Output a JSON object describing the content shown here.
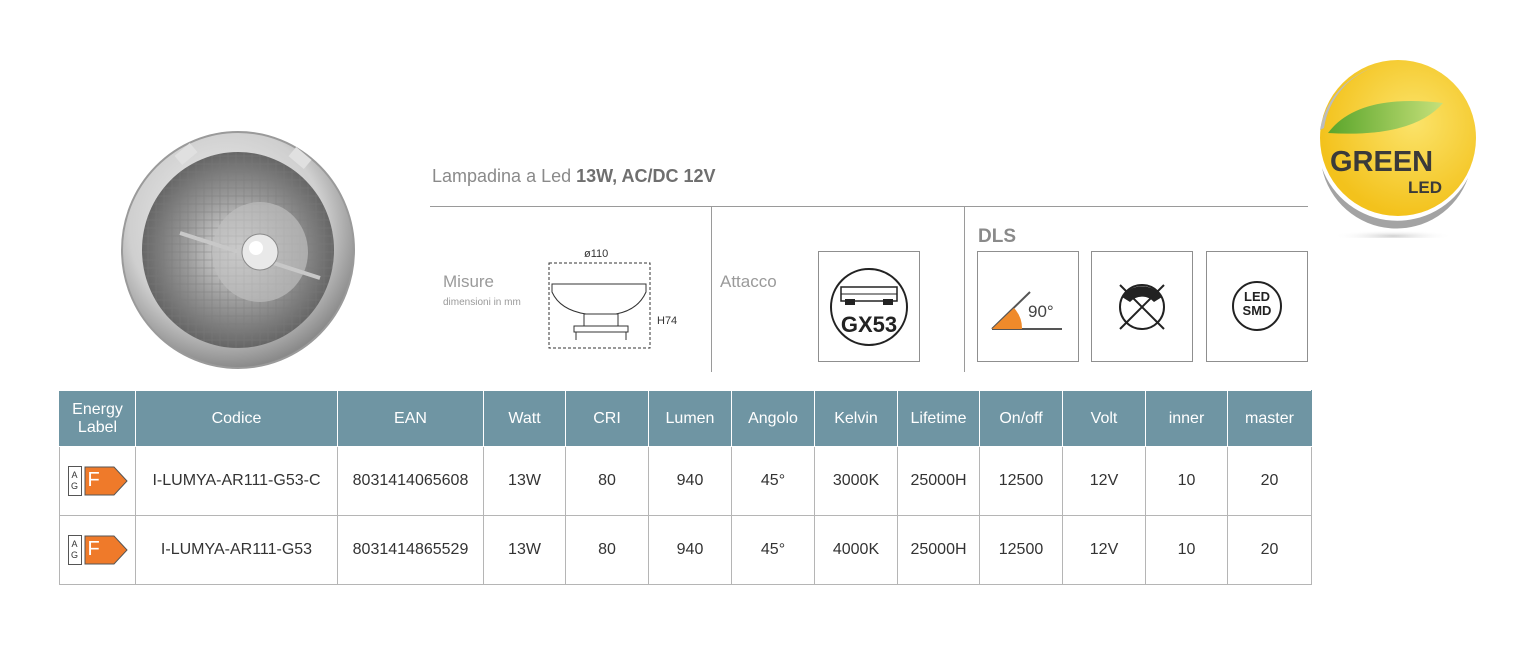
{
  "product": {
    "title_prefix": "Lampadina a Led",
    "title_specs": "13W, AC/DC 12V"
  },
  "sections": {
    "misure_label": "Misure",
    "misure_sub": "dimensioni in mm",
    "diameter": "ø110",
    "height": "H74",
    "attacco_label": "Attacco",
    "socket_code": "GX53",
    "dls_label": "DLS",
    "beam_angle": "90°",
    "led_type_line1": "LED",
    "led_type_line2": "SMD",
    "icons": [
      "beam-angle-icon",
      "no-dimmer-icon",
      "led-smd-icon"
    ]
  },
  "logo": {
    "word1": "GREEN",
    "word2": "LED",
    "colors": {
      "yellow": "#f3c21c",
      "green": "#8cc63f",
      "ring": "#a3a3a3"
    }
  },
  "table": {
    "header_color": "#6f95a3",
    "headers": [
      "Energy Label",
      "Codice",
      "EAN",
      "Watt",
      "CRI",
      "Lumen",
      "Angolo",
      "Kelvin",
      "Lifetime",
      "On/off",
      "Volt",
      "inner",
      "master"
    ],
    "energy_scale_top": "A",
    "energy_scale_bottom": "G",
    "rows": [
      {
        "energy_class": "F",
        "codice": "I-LUMYA-AR111-G53-C",
        "ean": "8031414065608",
        "watt": "13W",
        "cri": "80",
        "lumen": "940",
        "angolo": "45°",
        "kelvin": "3000K",
        "lifetime": "25000H",
        "onoff": "12500",
        "volt": "12V",
        "inner": "10",
        "master": "20"
      },
      {
        "energy_class": "F",
        "codice": "I-LUMYA-AR111-G53",
        "ean": "8031414865529",
        "watt": "13W",
        "cri": "80",
        "lumen": "940",
        "angolo": "45°",
        "kelvin": "4000K",
        "lifetime": "25000H",
        "onoff": "12500",
        "volt": "12V",
        "inner": "10",
        "master": "20"
      }
    ],
    "energy_color": "#ef7a2a"
  }
}
